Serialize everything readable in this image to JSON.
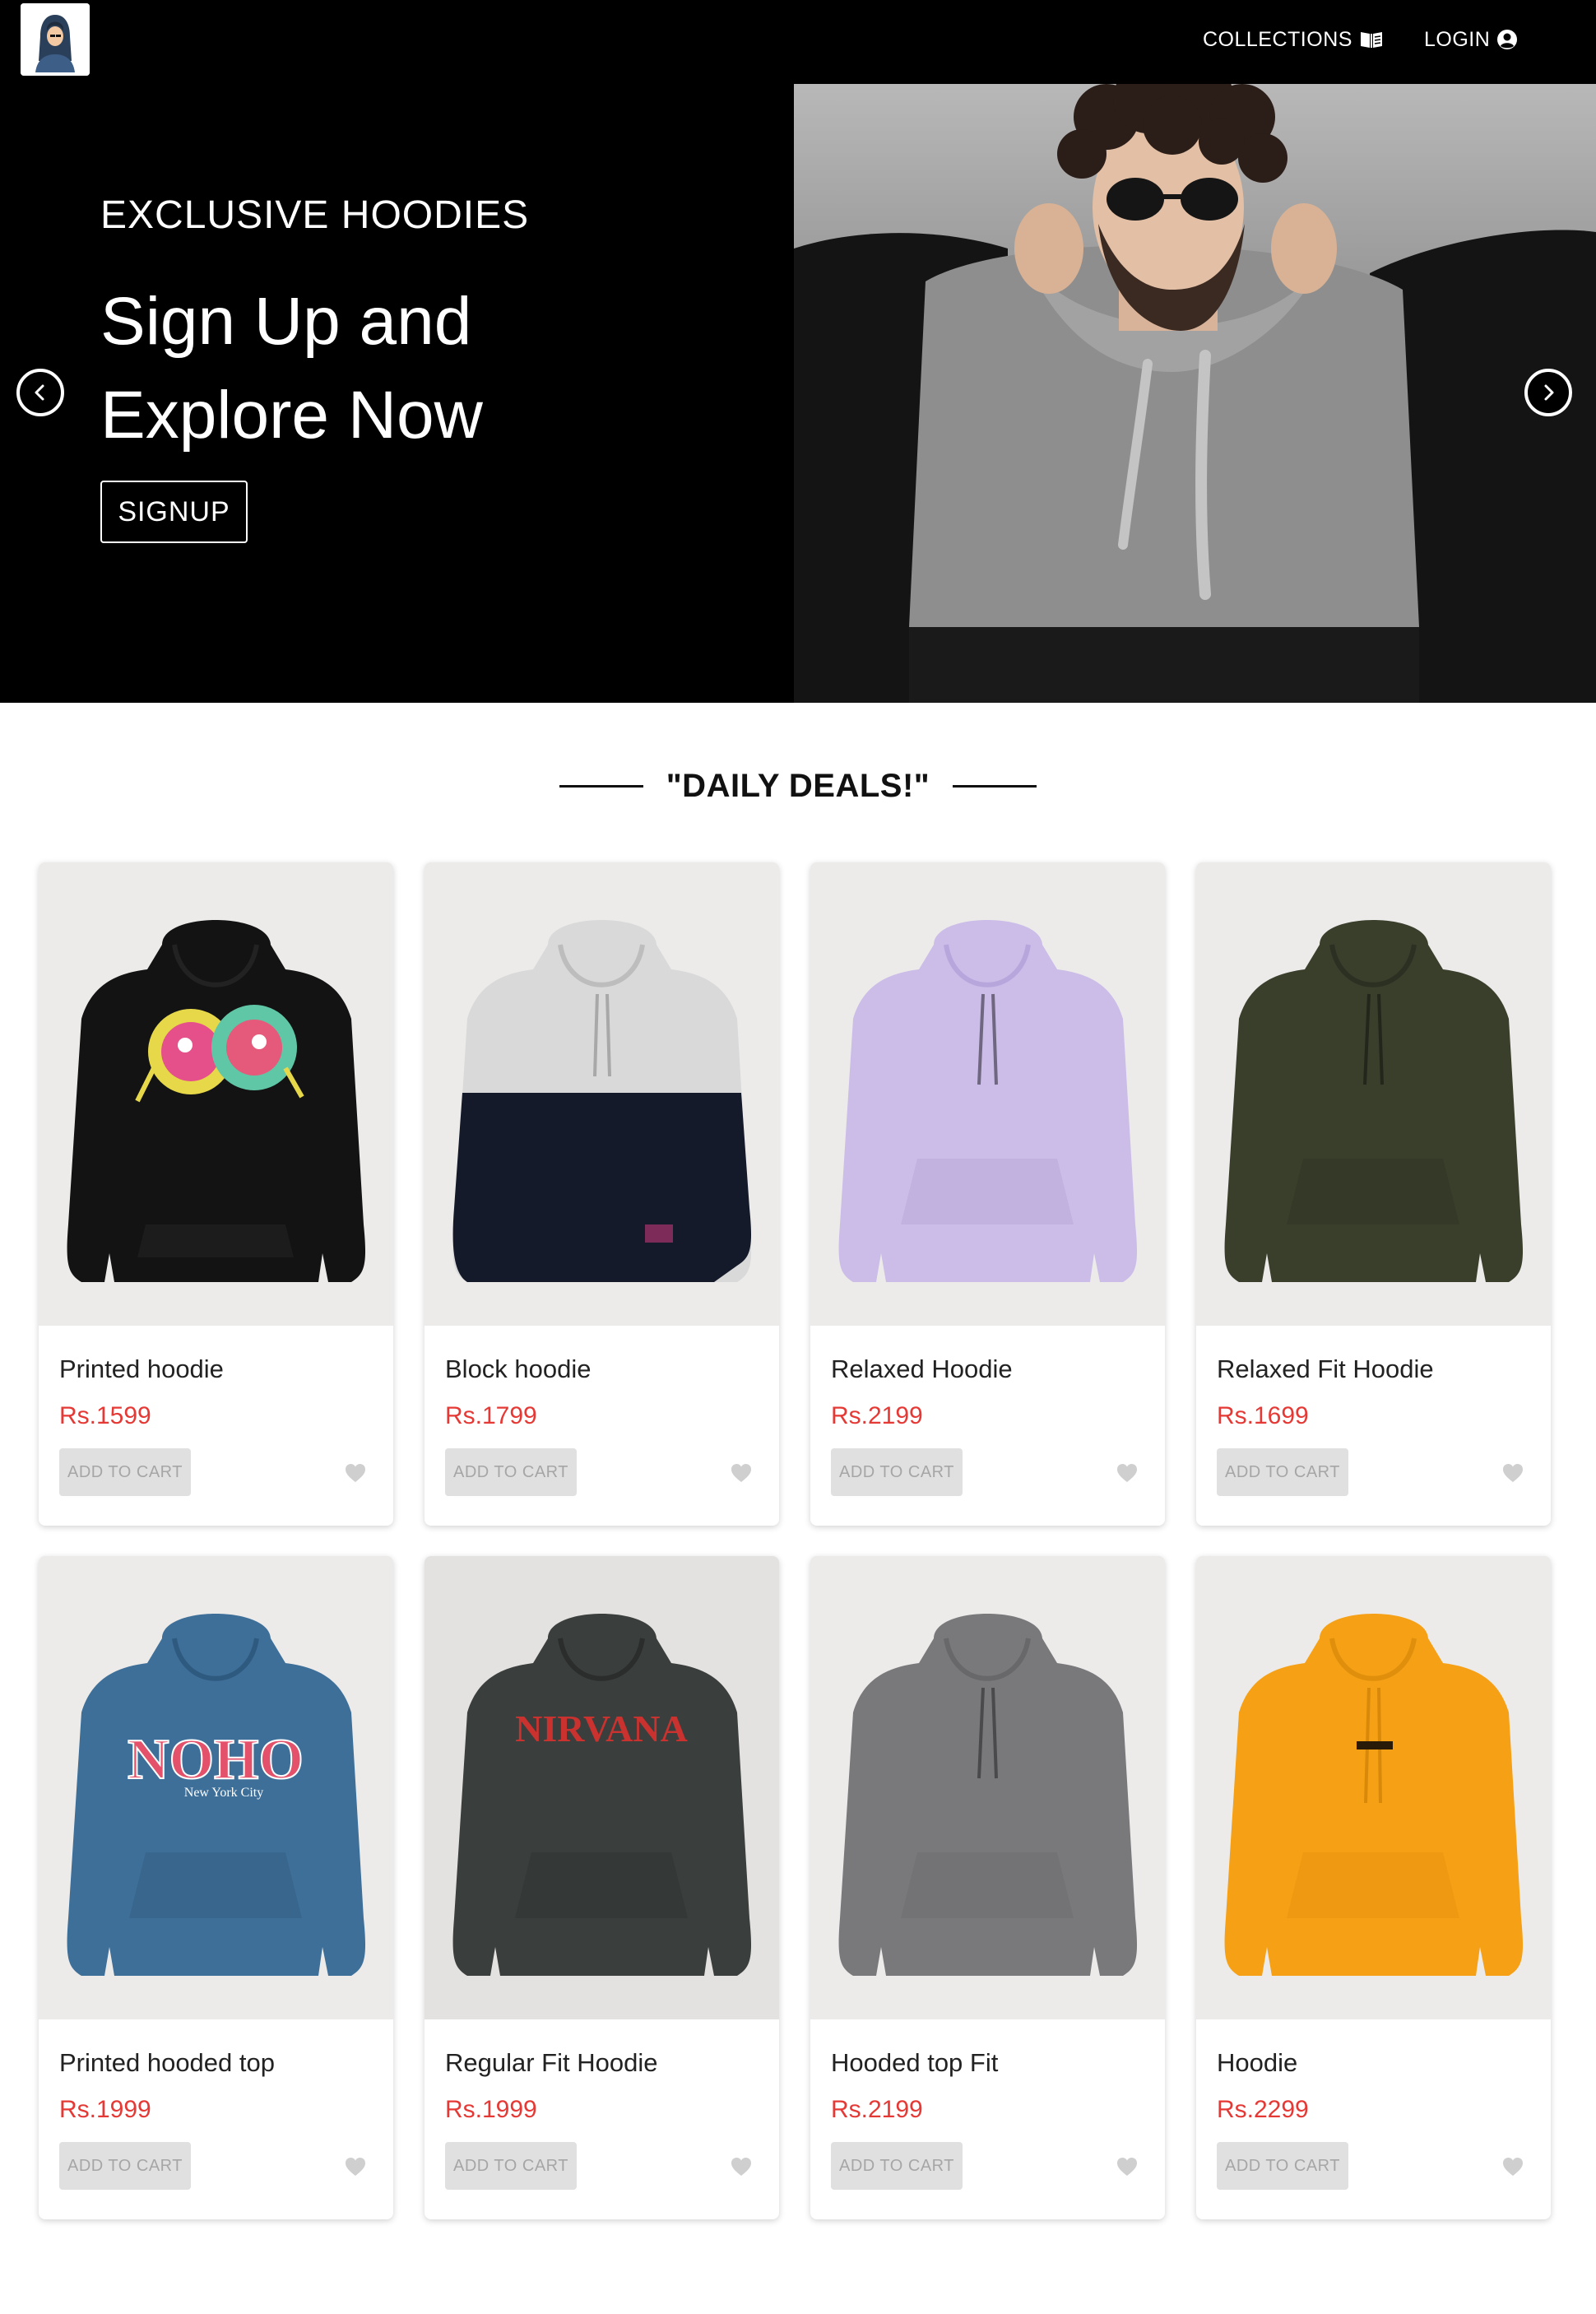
{
  "nav": {
    "collections_label": "COLLECTIONS",
    "login_label": "LOGIN"
  },
  "hero": {
    "kicker": "EXCLUSIVE HOODIES",
    "title": "Sign Up and Explore Now",
    "cta_label": "SIGNUP"
  },
  "section": {
    "title": "\"DAILY DEALS!\""
  },
  "products": [
    {
      "name": "Printed hoodie",
      "price": "Rs.1599",
      "cta": "ADD TO CART",
      "color": "#131313"
    },
    {
      "name": "Block hoodie",
      "price": "Rs.1799",
      "cta": "ADD TO CART",
      "color": "#d8d8d8"
    },
    {
      "name": "Relaxed Hoodie",
      "price": "Rs.2199",
      "cta": "ADD TO CART",
      "color": "#cbbde8"
    },
    {
      "name": "Relaxed Fit Hoodie",
      "price": "Rs.1699",
      "cta": "ADD TO CART",
      "color": "#3a3f2c"
    },
    {
      "name": "Printed hooded top",
      "price": "Rs.1999",
      "cta": "ADD TO CART",
      "color": "#3e6f99"
    },
    {
      "name": "Regular Fit Hoodie",
      "price": "Rs.1999",
      "cta": "ADD TO CART",
      "color": "#3a3e3c"
    },
    {
      "name": "Hooded top Fit",
      "price": "Rs.2199",
      "cta": "ADD TO CART",
      "color": "#79787b"
    },
    {
      "name": "Hoodie",
      "price": "Rs.2299",
      "cta": "ADD TO CART",
      "color": "#f5a015"
    }
  ],
  "graphics": {
    "nohoo_print": "NOHO",
    "nohoo_sub": "New York City",
    "nirvana_print": "NIRVANA"
  },
  "colors": {
    "price": "#e53935",
    "navbar": "#000000"
  }
}
